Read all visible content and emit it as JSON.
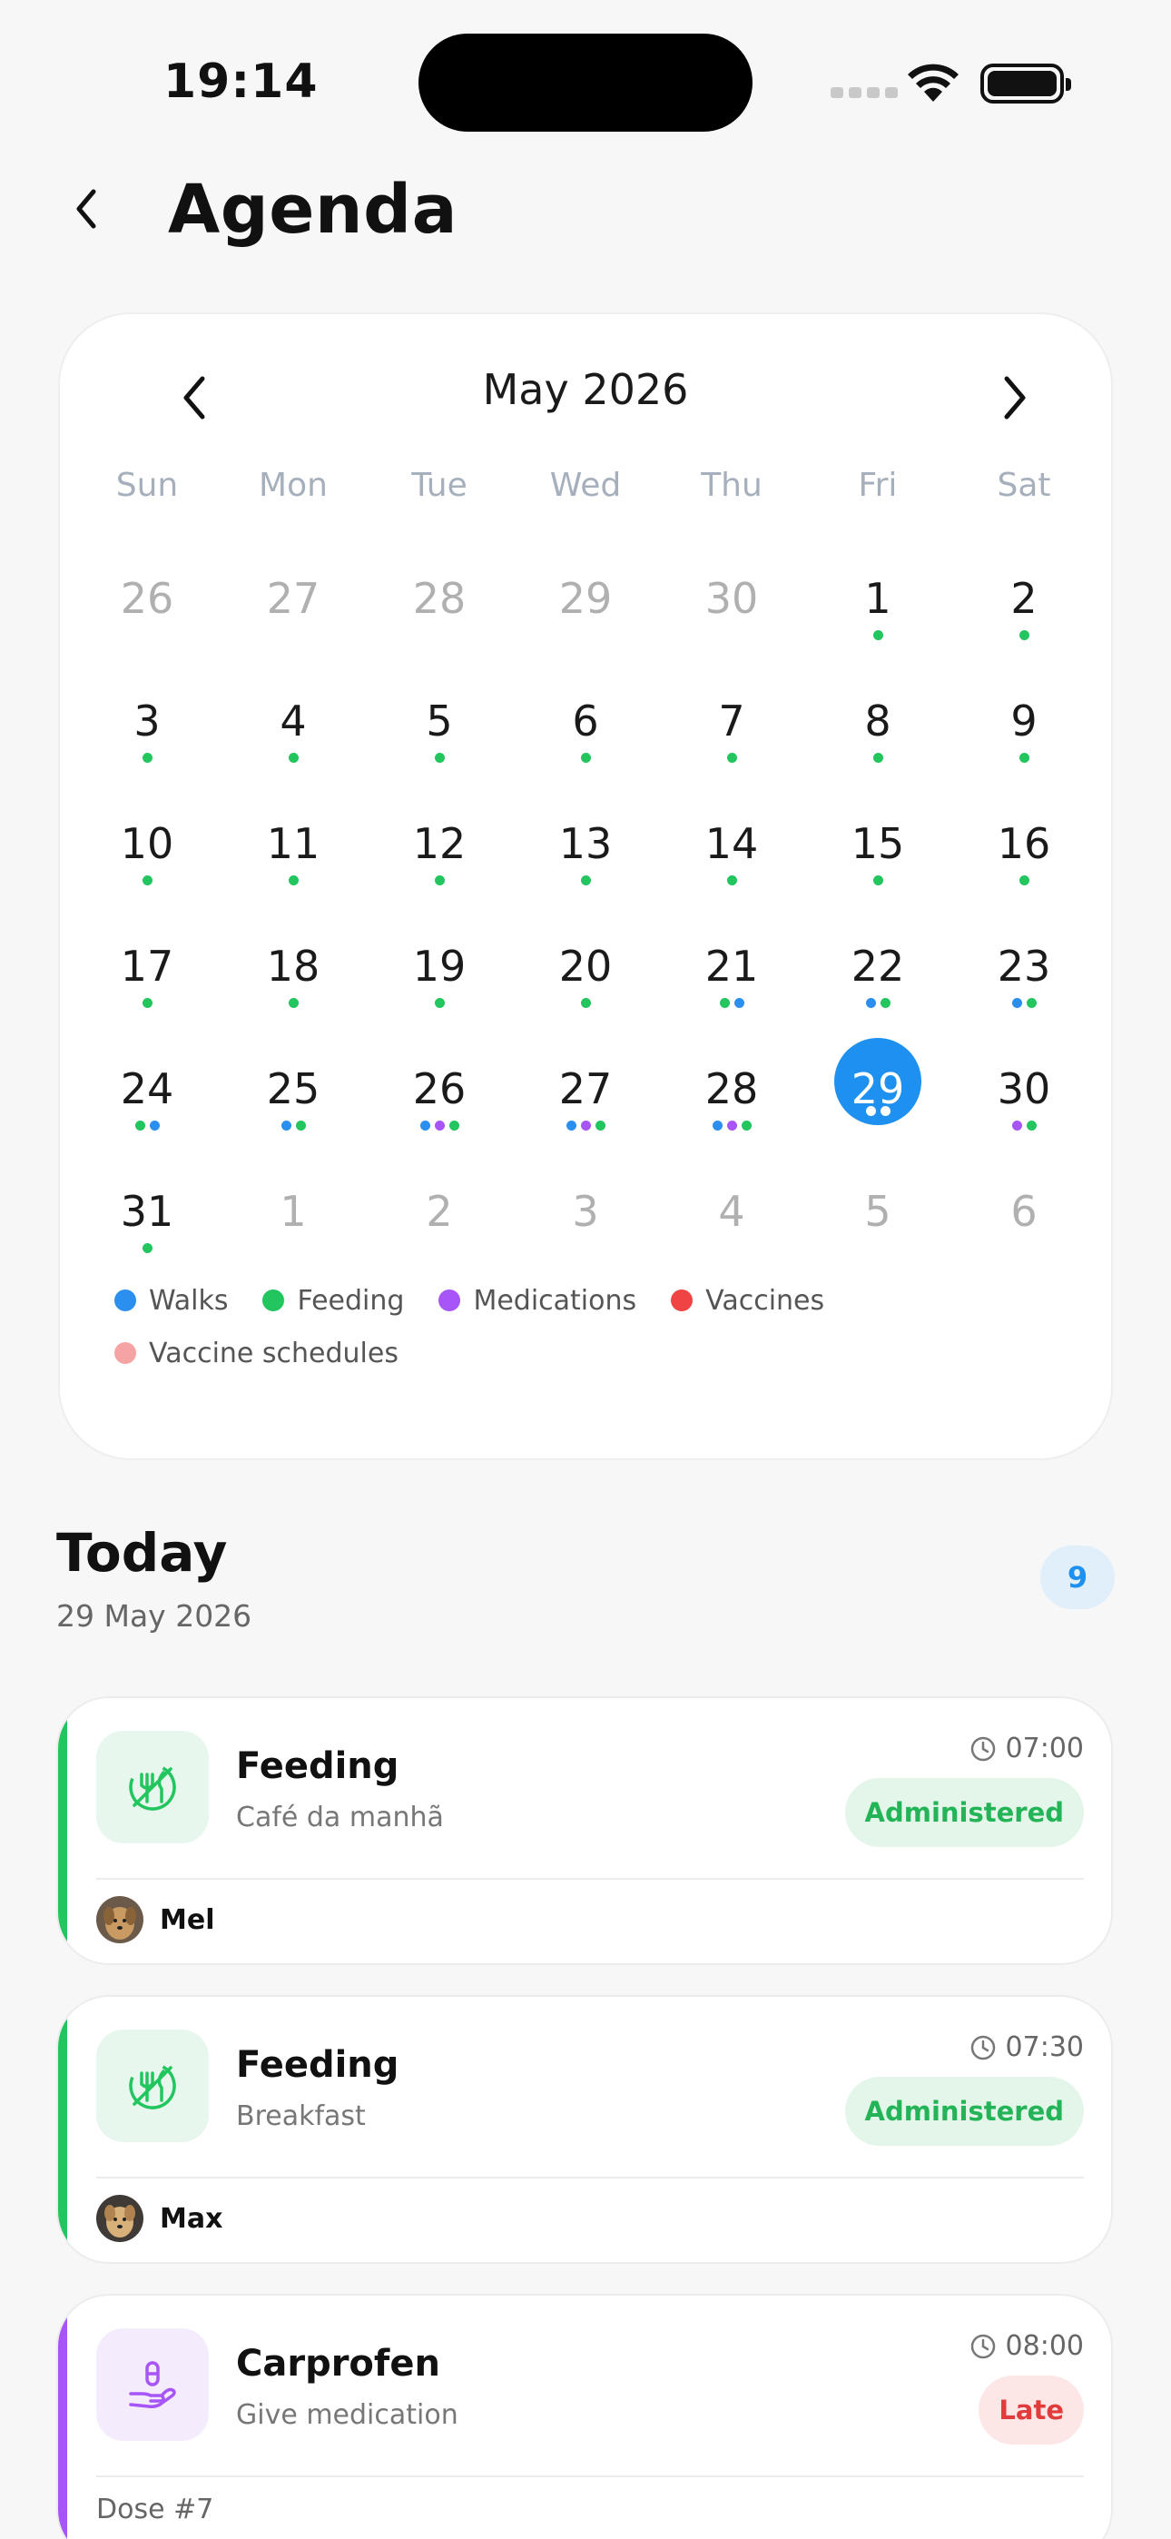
{
  "status_bar": {
    "time": "19:14"
  },
  "header": {
    "title": "Agenda"
  },
  "calendar": {
    "month_label": "May 2026",
    "weekdays": [
      "Sun",
      "Mon",
      "Tue",
      "Wed",
      "Thu",
      "Fri",
      "Sat"
    ],
    "colors": {
      "walks": "#2b8ff0",
      "feeding": "#22c55e",
      "medications": "#a855f7",
      "vaccines": "#ef4444",
      "vaccine_schedules": "#f5a3a3",
      "selected": "#1e90f0"
    },
    "weeks": [
      [
        {
          "d": "26",
          "other": true,
          "dots": []
        },
        {
          "d": "27",
          "other": true,
          "dots": []
        },
        {
          "d": "28",
          "other": true,
          "dots": []
        },
        {
          "d": "29",
          "other": true,
          "dots": []
        },
        {
          "d": "30",
          "other": true,
          "dots": []
        },
        {
          "d": "1",
          "dots": [
            "feeding"
          ]
        },
        {
          "d": "2",
          "dots": [
            "feeding"
          ]
        }
      ],
      [
        {
          "d": "3",
          "dots": [
            "feeding"
          ]
        },
        {
          "d": "4",
          "dots": [
            "feeding"
          ]
        },
        {
          "d": "5",
          "dots": [
            "feeding"
          ]
        },
        {
          "d": "6",
          "dots": [
            "feeding"
          ]
        },
        {
          "d": "7",
          "dots": [
            "feeding"
          ]
        },
        {
          "d": "8",
          "dots": [
            "feeding"
          ]
        },
        {
          "d": "9",
          "dots": [
            "feeding"
          ]
        }
      ],
      [
        {
          "d": "10",
          "dots": [
            "feeding"
          ]
        },
        {
          "d": "11",
          "dots": [
            "feeding"
          ]
        },
        {
          "d": "12",
          "dots": [
            "feeding"
          ]
        },
        {
          "d": "13",
          "dots": [
            "feeding"
          ]
        },
        {
          "d": "14",
          "dots": [
            "feeding"
          ]
        },
        {
          "d": "15",
          "dots": [
            "feeding"
          ]
        },
        {
          "d": "16",
          "dots": [
            "feeding"
          ]
        }
      ],
      [
        {
          "d": "17",
          "dots": [
            "feeding"
          ]
        },
        {
          "d": "18",
          "dots": [
            "feeding"
          ]
        },
        {
          "d": "19",
          "dots": [
            "feeding"
          ]
        },
        {
          "d": "20",
          "dots": [
            "feeding"
          ]
        },
        {
          "d": "21",
          "dots": [
            "feeding",
            "walks"
          ]
        },
        {
          "d": "22",
          "dots": [
            "walks",
            "feeding"
          ]
        },
        {
          "d": "23",
          "dots": [
            "walks",
            "feeding"
          ]
        }
      ],
      [
        {
          "d": "24",
          "dots": [
            "feeding",
            "walks"
          ]
        },
        {
          "d": "25",
          "dots": [
            "walks",
            "feeding"
          ]
        },
        {
          "d": "26",
          "dots": [
            "walks",
            "medications",
            "feeding"
          ]
        },
        {
          "d": "27",
          "dots": [
            "walks",
            "medications",
            "feeding"
          ]
        },
        {
          "d": "28",
          "dots": [
            "walks",
            "medications",
            "feeding"
          ]
        },
        {
          "d": "29",
          "selected": true,
          "dots": [
            "walks",
            "feeding"
          ]
        },
        {
          "d": "30",
          "dots": [
            "medications",
            "feeding"
          ]
        }
      ],
      [
        {
          "d": "31",
          "dots": [
            "feeding"
          ]
        },
        {
          "d": "1",
          "other": true,
          "dots": []
        },
        {
          "d": "2",
          "other": true,
          "dots": []
        },
        {
          "d": "3",
          "other": true,
          "dots": []
        },
        {
          "d": "4",
          "other": true,
          "dots": []
        },
        {
          "d": "5",
          "other": true,
          "dots": []
        },
        {
          "d": "6",
          "other": true,
          "dots": []
        }
      ]
    ],
    "legend": [
      {
        "key": "walks",
        "label": "Walks"
      },
      {
        "key": "feeding",
        "label": "Feeding"
      },
      {
        "key": "medications",
        "label": "Medications"
      },
      {
        "key": "vaccines",
        "label": "Vaccines"
      },
      {
        "key": "vaccine_schedules",
        "label": "Vaccine schedules"
      }
    ]
  },
  "today": {
    "title": "Today",
    "date": "29 May 2026",
    "count": "9"
  },
  "events": [
    {
      "title": "Feeding",
      "subtitle": "Café da manhã",
      "time": "07:00",
      "status": "Administered",
      "pet": "Mel",
      "accent": "#22c55e",
      "icon": "no-food-icon"
    },
    {
      "title": "Feeding",
      "subtitle": "Breakfast",
      "time": "07:30",
      "status": "Administered",
      "pet": "Max",
      "accent": "#22c55e",
      "icon": "no-food-icon"
    },
    {
      "title": "Carprofen",
      "subtitle": "Give medication",
      "time": "08:00",
      "status": "Late",
      "dose": "Dose #7",
      "accent": "#a855f7",
      "icon": "medication-hand-icon"
    }
  ]
}
